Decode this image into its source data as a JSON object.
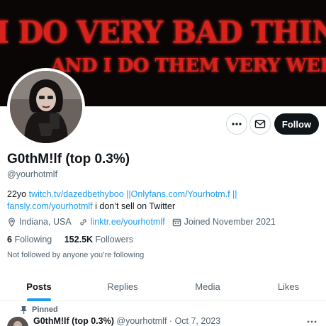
{
  "banner": {
    "line1": "I DO VERY BAD THINGS",
    "line2": "AND I DO THEM VERY WELL"
  },
  "actions": {
    "follow_label": "Follow"
  },
  "profile": {
    "display_name": "G0thM!lf (top 0.3%)",
    "handle": "@yourhotmlf",
    "bio_prefix": "22yo ",
    "bio_link1": "twitch.tv/dazedbethyboo ||Onlyfans.com/Yourhotm.f ||",
    "bio_link2": "fansly.com/yourhotmlf",
    "bio_suffix": " i don’t sell on Twitter",
    "location": "Indiana, USA",
    "website": "linktr.ee/yourhotmlf",
    "joined": "Joined November 2021",
    "following_count": "6",
    "following_label": "Following",
    "followers_count": "152.5K",
    "followers_label": "Followers",
    "not_followed": "Not followed by anyone you’re following"
  },
  "tabs": [
    {
      "label": "Posts",
      "active": true
    },
    {
      "label": "Replies",
      "active": false
    },
    {
      "label": "Media",
      "active": false
    },
    {
      "label": "Likes",
      "active": false
    }
  ],
  "pinned_post": {
    "pinned_label": "Pinned",
    "author": "G0thM!lf (top 0.3%)",
    "handle": "@yourhotmlf",
    "separator": "·",
    "date": "Oct 7, 2023"
  },
  "colors": {
    "accent": "#1d9bf0",
    "banner_text": "#d9221c",
    "follow_button": "#0f1419"
  },
  "icons": [
    "more-icon",
    "mail-icon",
    "location-icon",
    "link-icon",
    "calendar-icon",
    "pin-icon"
  ]
}
